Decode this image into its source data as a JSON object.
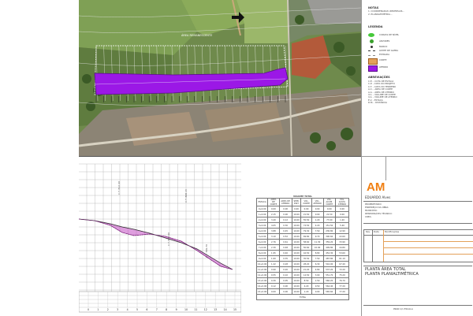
{
  "colors": {
    "cut_fill": "#9b18e6",
    "cut_outline": "#5a0f8a",
    "profile_fill": "#c24fc2",
    "orange_box": "#e3a15a",
    "purple_box": "#9b18e6",
    "logo_orange": "#f07f12",
    "grid": "#b0b0b0"
  },
  "map": {
    "arrow_icon": "arrow-right-icon",
    "parcel_label": "ÁREA REMANESCENTE"
  },
  "legend": {
    "notes_title": "NOTAS",
    "notes": [
      "1. COORDENADAS UNIVERSAIS...",
      "2. PLANIALTIMETRIA..."
    ],
    "title": "LEGENDA",
    "items": [
      {
        "symbol": "green-circle",
        "label": "CURVAS DE NÍVEL"
      },
      {
        "symbol": "green-circle",
        "label": "ÁRVORES"
      },
      {
        "symbol": "dot",
        "label": "MARCO"
      },
      {
        "symbol": "dash",
        "label": "LIMITE DE GLEBA"
      },
      {
        "symbol": "dash-gray",
        "label": "ESTRADA"
      },
      {
        "symbol": "orange-box",
        "label": "CORTE"
      },
      {
        "symbol": "purple-box",
        "label": "ATERRO"
      }
    ],
    "abbr_title": "ABREVIAÇÕES",
    "abbr": [
      "C.E. - COTA DE ESTACA",
      "C.P. - COTA DO PROJETO",
      "C.T. - COTA DO TERRENO",
      "A.C. - ÁREA DE CORTE",
      "A.A. - ÁREA DE ATERRO",
      "V.C. - VOLUME DE CORTE",
      "V.A. - VOLUME DE ATERRO",
      "E.V. - ESTACA",
      "D.M. - DISTÂNCIA"
    ]
  },
  "table": {
    "title": "VOLUME TOTAL",
    "headers": [
      "ESTACA",
      "ÁREA DE CORTE",
      "ÁREA DE ATERRO",
      "SEMI-DIST.",
      "VOL. CORTE",
      "VOL. ATERRO",
      "VOL. ACUM. CORTE",
      "VOL. ACUM. ATERRO"
    ],
    "rows": [
      [
        "0+0.00",
        "0.00",
        "0.00",
        "0.00",
        "0.00",
        "0.00",
        "0.00",
        "0.00"
      ],
      [
        "1+0.00",
        "2.15",
        "0.00",
        "10.00",
        "21.50",
        "0.00",
        "21.50",
        "0.00"
      ],
      [
        "2+0.00",
        "3.40",
        "0.12",
        "10.00",
        "55.50",
        "1.20",
        "77.00",
        "1.20"
      ],
      [
        "3+0.00",
        "4.05",
        "0.30",
        "10.00",
        "74.50",
        "4.20",
        "151.50",
        "5.40"
      ],
      [
        "4+0.00",
        "3.88",
        "0.45",
        "10.00",
        "79.30",
        "7.50",
        "230.80",
        "12.90"
      ],
      [
        "5+0.00",
        "3.10",
        "0.52",
        "10.00",
        "69.80",
        "9.70",
        "300.60",
        "22.60"
      ],
      [
        "6+0.00",
        "2.76",
        "0.61",
        "10.00",
        "58.60",
        "11.30",
        "359.20",
        "33.90"
      ],
      [
        "7+0.00",
        "2.30",
        "0.48",
        "10.00",
        "50.60",
        "10.90",
        "409.80",
        "44.80"
      ],
      [
        "8+0.00",
        "1.95",
        "0.40",
        "10.00",
        "42.50",
        "8.80",
        "452.30",
        "53.60"
      ],
      [
        "9+0.00",
        "1.60",
        "0.35",
        "10.00",
        "35.50",
        "7.50",
        "487.80",
        "61.10"
      ],
      [
        "10+0.00",
        "1.22",
        "0.28",
        "10.00",
        "28.20",
        "6.30",
        "516.00",
        "67.40"
      ],
      [
        "11+0.00",
        "0.90",
        "0.20",
        "10.00",
        "21.20",
        "4.80",
        "537.20",
        "72.20"
      ],
      [
        "12+0.00",
        "0.55",
        "0.10",
        "10.00",
        "14.50",
        "3.00",
        "551.70",
        "75.20"
      ],
      [
        "13+0.00",
        "0.30",
        "0.05",
        "10.00",
        "8.50",
        "1.50",
        "560.20",
        "76.70"
      ],
      [
        "14+0.00",
        "0.12",
        "0.00",
        "10.00",
        "4.20",
        "0.50",
        "564.40",
        "77.20"
      ],
      [
        "15+0.00",
        "0.00",
        "0.00",
        "10.00",
        "1.20",
        "0.00",
        "565.60",
        "77.20"
      ]
    ],
    "total_label": "TOTAL"
  },
  "profile": {
    "stations": [
      "0",
      "1",
      "2",
      "3",
      "4",
      "5",
      "6",
      "7",
      "8",
      "9",
      "10",
      "11",
      "12",
      "13",
      "14",
      "15"
    ],
    "elev_labels": [
      "",
      "",
      "",
      ""
    ],
    "note_texts": [
      "C.T. 812.40",
      "C.T. 808.15",
      "C.T. 803.90",
      "C.T. 799.70"
    ]
  },
  "title_block": {
    "logo": "AM",
    "client": "EDUARDO Alves",
    "notes": [
      "PROPRIETÁRIO:",
      "ENDEREÇO DA OBRA:",
      "MUNICÍPIO:",
      "RESPONSÁVEL TÉCNICO:",
      "CREA:"
    ],
    "rev_headers": [
      "Rev.",
      "Data",
      "Modificações"
    ],
    "title_1": "PLANTA ÁREA TOTAL",
    "title_2": "PLANTA PLANIALTIMÉTRICA",
    "sheet": "PRAN 1/1 ESCALA"
  }
}
